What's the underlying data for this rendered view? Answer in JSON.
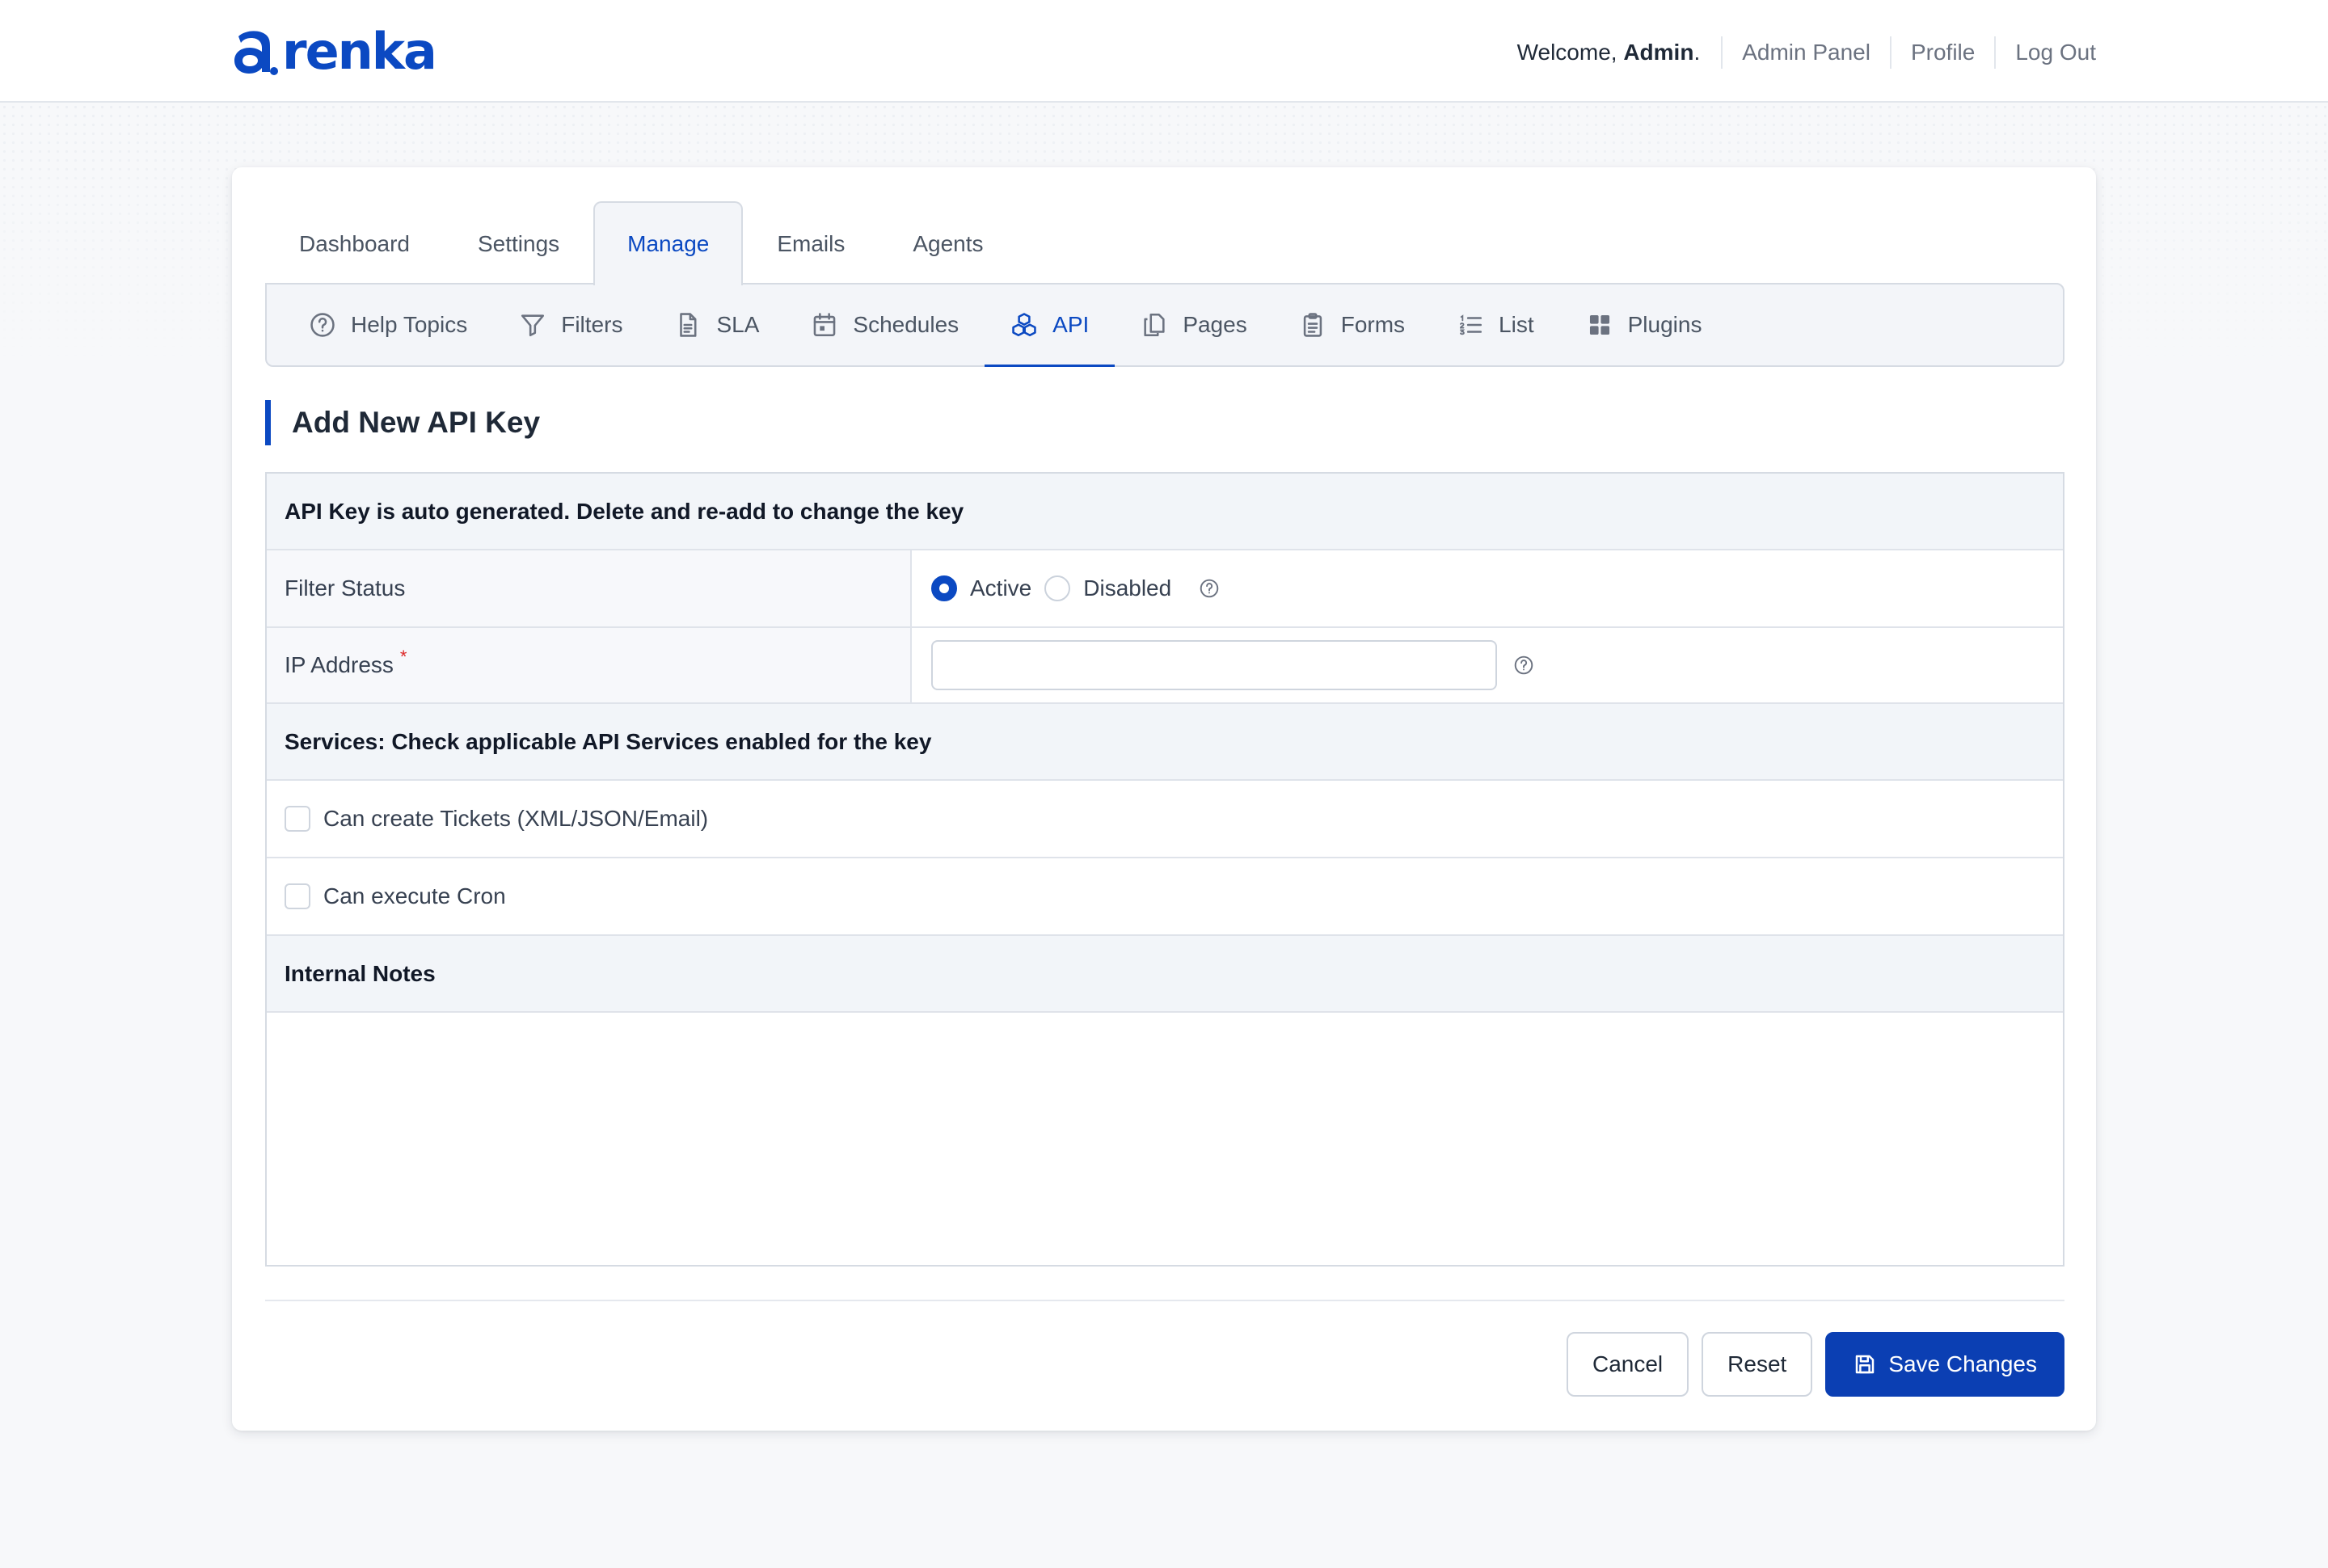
{
  "brand": {
    "name": "renka",
    "color": "#0b49c2"
  },
  "topnav": {
    "welcome_prefix": "Welcome, ",
    "user": "Admin",
    "welcome_suffix": ".",
    "links": [
      "Admin Panel",
      "Profile",
      "Log Out"
    ]
  },
  "tabs": [
    {
      "label": "Dashboard",
      "active": false
    },
    {
      "label": "Settings",
      "active": false
    },
    {
      "label": "Manage",
      "active": true
    },
    {
      "label": "Emails",
      "active": false
    },
    {
      "label": "Agents",
      "active": false
    }
  ],
  "subnav": [
    {
      "label": "Help Topics",
      "icon": "help-circle-icon"
    },
    {
      "label": "Filters",
      "icon": "filter-icon"
    },
    {
      "label": "SLA",
      "icon": "document-icon"
    },
    {
      "label": "Schedules",
      "icon": "calendar-icon"
    },
    {
      "label": "API",
      "icon": "cubes-icon",
      "active": true
    },
    {
      "label": "Pages",
      "icon": "pages-icon"
    },
    {
      "label": "Forms",
      "icon": "clipboard-icon"
    },
    {
      "label": "List",
      "icon": "list-icon"
    },
    {
      "label": "Plugins",
      "icon": "grid-icon"
    }
  ],
  "form": {
    "title": "Add New API Key",
    "note": "API Key is auto generated. Delete and re-add to change the key",
    "filter_status": {
      "label": "Filter Status",
      "options": [
        "Active",
        "Disabled"
      ],
      "selected": "Active"
    },
    "ip_address": {
      "label": "IP Address",
      "required_mark": "*",
      "value": "",
      "placeholder": ""
    },
    "services_header": "Services: Check applicable API Services enabled for the key",
    "services": [
      {
        "label": "Can create Tickets (XML/JSON/Email)",
        "checked": false
      },
      {
        "label": "Can execute Cron",
        "checked": false
      }
    ],
    "notes_header": "Internal Notes",
    "notes_value": ""
  },
  "actions": {
    "cancel": "Cancel",
    "reset": "Reset",
    "save": "Save Changes"
  },
  "colors": {
    "accent": "#0b49c2",
    "primary_button": "#0b3fb3",
    "border": "#d6dbe3"
  }
}
